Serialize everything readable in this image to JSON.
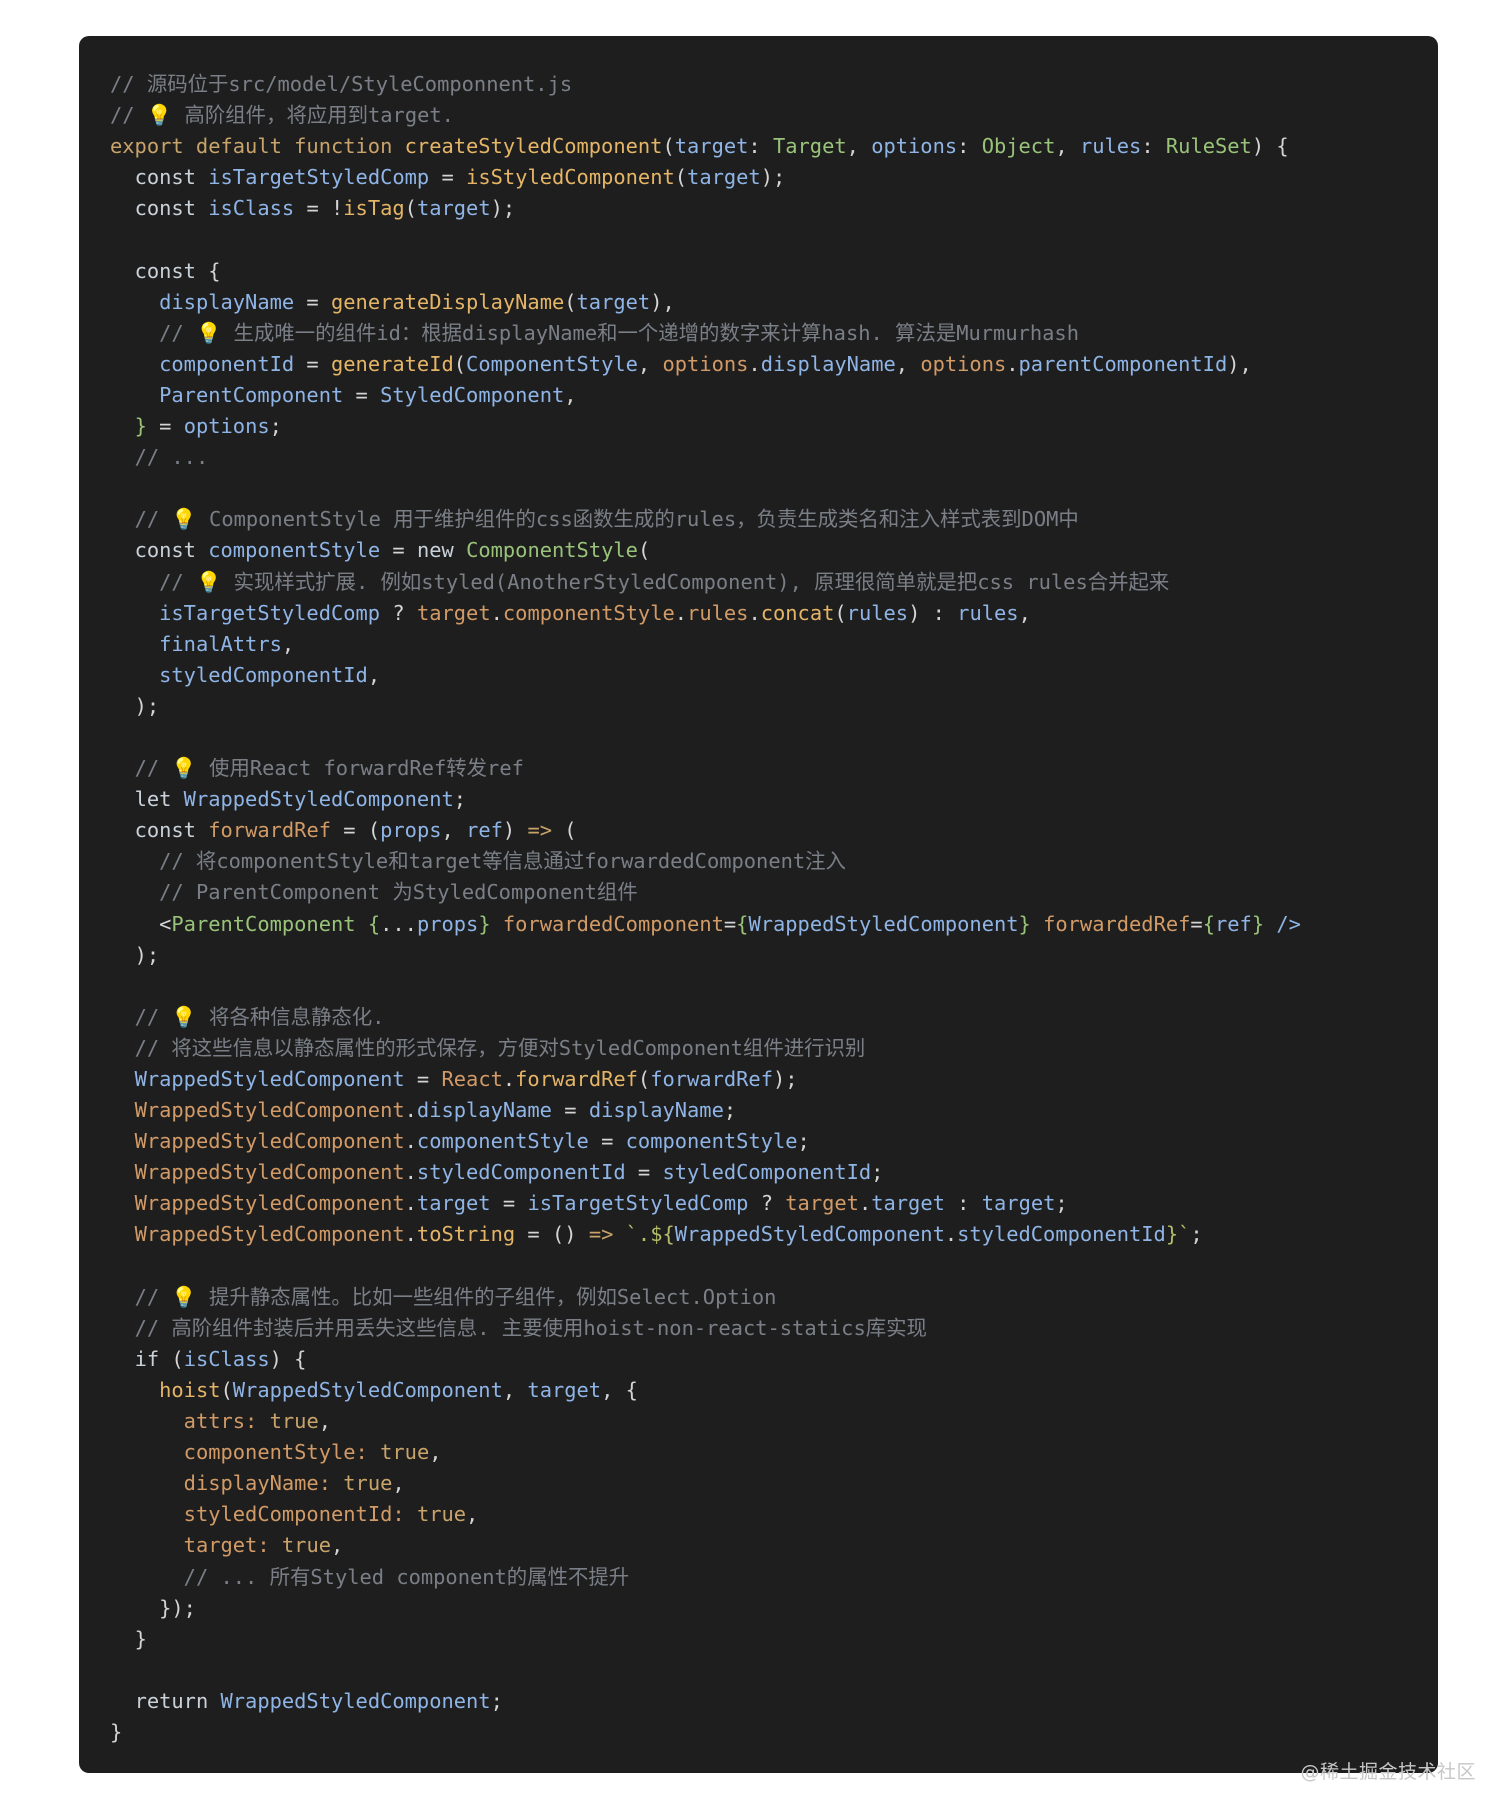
{
  "colors": {
    "background": "#1e1e1e",
    "default": "#c9d1d9",
    "comment": "#7a7f87",
    "keyword": "#c8a36a",
    "function": "#e5b567",
    "type": "#98c379",
    "variable": "#8fb4e6",
    "property": "#d19a66",
    "punctuation": "#d4d4d4",
    "string": "#b5bd68"
  },
  "watermark": "@稀土掘金技术社区",
  "code_lines": [
    [
      [
        "comment",
        "// 源码位于src/model/StyleComponnent.js"
      ]
    ],
    [
      [
        "comment",
        "// 💡 高阶组件，将应用到target."
      ]
    ],
    [
      [
        "keyword",
        "export default function "
      ],
      [
        "function",
        "createStyledComponent"
      ],
      [
        "punctuation",
        "("
      ],
      [
        "variable",
        "target"
      ],
      [
        "punctuation",
        ": "
      ],
      [
        "type",
        "Target"
      ],
      [
        "punctuation",
        ", "
      ],
      [
        "variable",
        "options"
      ],
      [
        "punctuation",
        ": "
      ],
      [
        "type",
        "Object"
      ],
      [
        "punctuation",
        ", "
      ],
      [
        "variable",
        "rules"
      ],
      [
        "punctuation",
        ": "
      ],
      [
        "type",
        "RuleSet"
      ],
      [
        "punctuation",
        ") {"
      ]
    ],
    [
      [
        "default",
        "  "
      ],
      [
        "keyword2",
        "const "
      ],
      [
        "variable",
        "isTargetStyledComp"
      ],
      [
        "punctuation",
        " = "
      ],
      [
        "function",
        "isStyledComponent"
      ],
      [
        "punctuation",
        "("
      ],
      [
        "variable",
        "target"
      ],
      [
        "punctuation",
        ");"
      ]
    ],
    [
      [
        "default",
        "  "
      ],
      [
        "keyword2",
        "const "
      ],
      [
        "variable",
        "isClass"
      ],
      [
        "punctuation",
        " = !"
      ],
      [
        "function",
        "isTag"
      ],
      [
        "punctuation",
        "("
      ],
      [
        "variable",
        "target"
      ],
      [
        "punctuation",
        ");"
      ]
    ],
    [
      [
        "default",
        ""
      ]
    ],
    [
      [
        "default",
        "  "
      ],
      [
        "keyword2",
        "const "
      ],
      [
        "punctuation",
        "{"
      ]
    ],
    [
      [
        "default",
        "    "
      ],
      [
        "variable",
        "displayName"
      ],
      [
        "punctuation",
        " = "
      ],
      [
        "function",
        "generateDisplayName"
      ],
      [
        "punctuation",
        "("
      ],
      [
        "variable",
        "target"
      ],
      [
        "punctuation",
        "),"
      ]
    ],
    [
      [
        "default",
        "    "
      ],
      [
        "comment",
        "// 💡 生成唯一的组件id：根据displayName和一个递增的数字来计算hash. 算法是Murmurhash"
      ]
    ],
    [
      [
        "default",
        "    "
      ],
      [
        "variable",
        "componentId"
      ],
      [
        "punctuation",
        " = "
      ],
      [
        "function",
        "generateId"
      ],
      [
        "punctuation",
        "("
      ],
      [
        "variable",
        "ComponentStyle"
      ],
      [
        "punctuation",
        ", "
      ],
      [
        "property",
        "options"
      ],
      [
        "punctuation",
        "."
      ],
      [
        "variable",
        "displayName"
      ],
      [
        "punctuation",
        ", "
      ],
      [
        "property",
        "options"
      ],
      [
        "punctuation",
        "."
      ],
      [
        "variable",
        "parentComponentId"
      ],
      [
        "punctuation",
        "),"
      ]
    ],
    [
      [
        "default",
        "    "
      ],
      [
        "variable",
        "ParentComponent"
      ],
      [
        "punctuation",
        " = "
      ],
      [
        "variable",
        "StyledComponent"
      ],
      [
        "punctuation",
        ","
      ]
    ],
    [
      [
        "default",
        "  "
      ],
      [
        "type",
        "}"
      ],
      [
        "punctuation",
        " = "
      ],
      [
        "variable",
        "options"
      ],
      [
        "punctuation",
        ";"
      ]
    ],
    [
      [
        "default",
        "  "
      ],
      [
        "comment",
        "// ..."
      ]
    ],
    [
      [
        "default",
        ""
      ]
    ],
    [
      [
        "default",
        "  "
      ],
      [
        "comment",
        "// 💡 ComponentStyle 用于维护组件的css函数生成的rules，负责生成类名和注入样式表到DOM中"
      ]
    ],
    [
      [
        "default",
        "  "
      ],
      [
        "keyword2",
        "const "
      ],
      [
        "variable",
        "componentStyle"
      ],
      [
        "punctuation",
        " = "
      ],
      [
        "keyword2",
        "new "
      ],
      [
        "type",
        "ComponentStyle"
      ],
      [
        "punctuation",
        "("
      ]
    ],
    [
      [
        "default",
        "    "
      ],
      [
        "comment",
        "// 💡 实现样式扩展. 例如styled(AnotherStyledComponent), 原理很简单就是把css rules合并起来"
      ]
    ],
    [
      [
        "default",
        "    "
      ],
      [
        "variable",
        "isTargetStyledComp"
      ],
      [
        "punctuation",
        " ? "
      ],
      [
        "property",
        "target"
      ],
      [
        "punctuation",
        "."
      ],
      [
        "property",
        "componentStyle"
      ],
      [
        "punctuation",
        "."
      ],
      [
        "property",
        "rules"
      ],
      [
        "punctuation",
        "."
      ],
      [
        "function",
        "concat"
      ],
      [
        "punctuation",
        "("
      ],
      [
        "variable",
        "rules"
      ],
      [
        "punctuation",
        ") : "
      ],
      [
        "variable",
        "rules"
      ],
      [
        "punctuation",
        ","
      ]
    ],
    [
      [
        "default",
        "    "
      ],
      [
        "variable",
        "finalAttrs"
      ],
      [
        "punctuation",
        ","
      ]
    ],
    [
      [
        "default",
        "    "
      ],
      [
        "variable",
        "styledComponentId"
      ],
      [
        "punctuation",
        ","
      ]
    ],
    [
      [
        "default",
        "  "
      ],
      [
        "punctuation",
        ");"
      ]
    ],
    [
      [
        "default",
        ""
      ]
    ],
    [
      [
        "default",
        "  "
      ],
      [
        "comment",
        "// 💡 使用React forwardRef转发ref"
      ]
    ],
    [
      [
        "default",
        "  "
      ],
      [
        "keyword2",
        "let "
      ],
      [
        "variable",
        "WrappedStyledComponent"
      ],
      [
        "punctuation",
        ";"
      ]
    ],
    [
      [
        "default",
        "  "
      ],
      [
        "keyword2",
        "const "
      ],
      [
        "property",
        "forwardRef"
      ],
      [
        "punctuation",
        " = ("
      ],
      [
        "variable",
        "props"
      ],
      [
        "punctuation",
        ", "
      ],
      [
        "variable",
        "ref"
      ],
      [
        "punctuation",
        ") "
      ],
      [
        "keyword",
        "=>"
      ],
      [
        "punctuation",
        " ("
      ]
    ],
    [
      [
        "default",
        "    "
      ],
      [
        "comment",
        "// 将componentStyle和target等信息通过forwardedComponent注入"
      ]
    ],
    [
      [
        "default",
        "    "
      ],
      [
        "comment",
        "// ParentComponent 为StyledComponent组件"
      ]
    ],
    [
      [
        "default",
        "    "
      ],
      [
        "punctuation",
        "<"
      ],
      [
        "type",
        "ParentComponent"
      ],
      [
        "punctuation",
        " "
      ],
      [
        "type",
        "{"
      ],
      [
        "punctuation",
        "..."
      ],
      [
        "variable",
        "props"
      ],
      [
        "type",
        "}"
      ],
      [
        "punctuation",
        " "
      ],
      [
        "property",
        "forwardedComponent"
      ],
      [
        "punctuation",
        "="
      ],
      [
        "type",
        "{"
      ],
      [
        "variable",
        "WrappedStyledComponent"
      ],
      [
        "type",
        "}"
      ],
      [
        "punctuation",
        " "
      ],
      [
        "property",
        "forwardedRef"
      ],
      [
        "punctuation",
        "="
      ],
      [
        "type",
        "{"
      ],
      [
        "variable",
        "ref"
      ],
      [
        "type",
        "}"
      ],
      [
        "punctuation",
        " "
      ],
      [
        "variable",
        "/>"
      ]
    ],
    [
      [
        "default",
        "  "
      ],
      [
        "punctuation",
        ");"
      ]
    ],
    [
      [
        "default",
        ""
      ]
    ],
    [
      [
        "default",
        "  "
      ],
      [
        "comment",
        "// 💡 将各种信息静态化."
      ]
    ],
    [
      [
        "default",
        "  "
      ],
      [
        "comment",
        "// 将这些信息以静态属性的形式保存，方便对StyledComponent组件进行识别"
      ]
    ],
    [
      [
        "default",
        "  "
      ],
      [
        "variable",
        "WrappedStyledComponent"
      ],
      [
        "punctuation",
        " = "
      ],
      [
        "property",
        "React"
      ],
      [
        "punctuation",
        "."
      ],
      [
        "function",
        "forwardRef"
      ],
      [
        "punctuation",
        "("
      ],
      [
        "variable",
        "forwardRef"
      ],
      [
        "punctuation",
        ");"
      ]
    ],
    [
      [
        "default",
        "  "
      ],
      [
        "property",
        "WrappedStyledComponent"
      ],
      [
        "punctuation",
        "."
      ],
      [
        "variable",
        "displayName"
      ],
      [
        "punctuation",
        " = "
      ],
      [
        "variable",
        "displayName"
      ],
      [
        "punctuation",
        ";"
      ]
    ],
    [
      [
        "default",
        "  "
      ],
      [
        "property",
        "WrappedStyledComponent"
      ],
      [
        "punctuation",
        "."
      ],
      [
        "variable",
        "componentStyle"
      ],
      [
        "punctuation",
        " = "
      ],
      [
        "variable",
        "componentStyle"
      ],
      [
        "punctuation",
        ";"
      ]
    ],
    [
      [
        "default",
        "  "
      ],
      [
        "property",
        "WrappedStyledComponent"
      ],
      [
        "punctuation",
        "."
      ],
      [
        "variable",
        "styledComponentId"
      ],
      [
        "punctuation",
        " = "
      ],
      [
        "variable",
        "styledComponentId"
      ],
      [
        "punctuation",
        ";"
      ]
    ],
    [
      [
        "default",
        "  "
      ],
      [
        "property",
        "WrappedStyledComponent"
      ],
      [
        "punctuation",
        "."
      ],
      [
        "variable",
        "target"
      ],
      [
        "punctuation",
        " = "
      ],
      [
        "variable",
        "isTargetStyledComp"
      ],
      [
        "punctuation",
        " ? "
      ],
      [
        "property",
        "target"
      ],
      [
        "punctuation",
        "."
      ],
      [
        "variable",
        "target"
      ],
      [
        "punctuation",
        " : "
      ],
      [
        "variable",
        "target"
      ],
      [
        "punctuation",
        ";"
      ]
    ],
    [
      [
        "default",
        "  "
      ],
      [
        "property",
        "WrappedStyledComponent"
      ],
      [
        "punctuation",
        "."
      ],
      [
        "function",
        "toString"
      ],
      [
        "punctuation",
        " = () "
      ],
      [
        "keyword",
        "=>"
      ],
      [
        "punctuation",
        " "
      ],
      [
        "string",
        "`.${"
      ],
      [
        "variable",
        "WrappedStyledComponent"
      ],
      [
        "punctuation",
        "."
      ],
      [
        "variable",
        "styledComponentId"
      ],
      [
        "string",
        "}`"
      ],
      [
        "punctuation",
        ";"
      ]
    ],
    [
      [
        "default",
        ""
      ]
    ],
    [
      [
        "default",
        "  "
      ],
      [
        "comment",
        "// 💡 提升静态属性。比如一些组件的子组件，例如Select.Option"
      ]
    ],
    [
      [
        "default",
        "  "
      ],
      [
        "comment",
        "// 高阶组件封装后并用丢失这些信息. 主要使用hoist-non-react-statics库实现"
      ]
    ],
    [
      [
        "default",
        "  "
      ],
      [
        "keyword2",
        "if "
      ],
      [
        "punctuation",
        "("
      ],
      [
        "variable",
        "isClass"
      ],
      [
        "punctuation",
        ") {"
      ]
    ],
    [
      [
        "default",
        "    "
      ],
      [
        "function",
        "hoist"
      ],
      [
        "punctuation",
        "("
      ],
      [
        "variable",
        "WrappedStyledComponent"
      ],
      [
        "punctuation",
        ", "
      ],
      [
        "variable",
        "target"
      ],
      [
        "punctuation",
        ", {"
      ]
    ],
    [
      [
        "default",
        "      "
      ],
      [
        "property",
        "attrs:"
      ],
      [
        "punctuation",
        " "
      ],
      [
        "keyword",
        "true"
      ],
      [
        "punctuation",
        ","
      ]
    ],
    [
      [
        "default",
        "      "
      ],
      [
        "property",
        "componentStyle:"
      ],
      [
        "punctuation",
        " "
      ],
      [
        "keyword",
        "true"
      ],
      [
        "punctuation",
        ","
      ]
    ],
    [
      [
        "default",
        "      "
      ],
      [
        "property",
        "displayName:"
      ],
      [
        "punctuation",
        " "
      ],
      [
        "keyword",
        "true"
      ],
      [
        "punctuation",
        ","
      ]
    ],
    [
      [
        "default",
        "      "
      ],
      [
        "property",
        "styledComponentId:"
      ],
      [
        "punctuation",
        " "
      ],
      [
        "keyword",
        "true"
      ],
      [
        "punctuation",
        ","
      ]
    ],
    [
      [
        "default",
        "      "
      ],
      [
        "property",
        "target:"
      ],
      [
        "punctuation",
        " "
      ],
      [
        "keyword",
        "true"
      ],
      [
        "punctuation",
        ","
      ]
    ],
    [
      [
        "default",
        "      "
      ],
      [
        "comment",
        "// ... 所有Styled component的属性不提升"
      ]
    ],
    [
      [
        "default",
        "    "
      ],
      [
        "punctuation",
        "});"
      ]
    ],
    [
      [
        "default",
        "  "
      ],
      [
        "punctuation",
        "}"
      ]
    ],
    [
      [
        "default",
        ""
      ]
    ],
    [
      [
        "default",
        "  "
      ],
      [
        "keyword2",
        "return "
      ],
      [
        "variable",
        "WrappedStyledComponent"
      ],
      [
        "punctuation",
        ";"
      ]
    ],
    [
      [
        "punctuation",
        "}"
      ]
    ]
  ]
}
